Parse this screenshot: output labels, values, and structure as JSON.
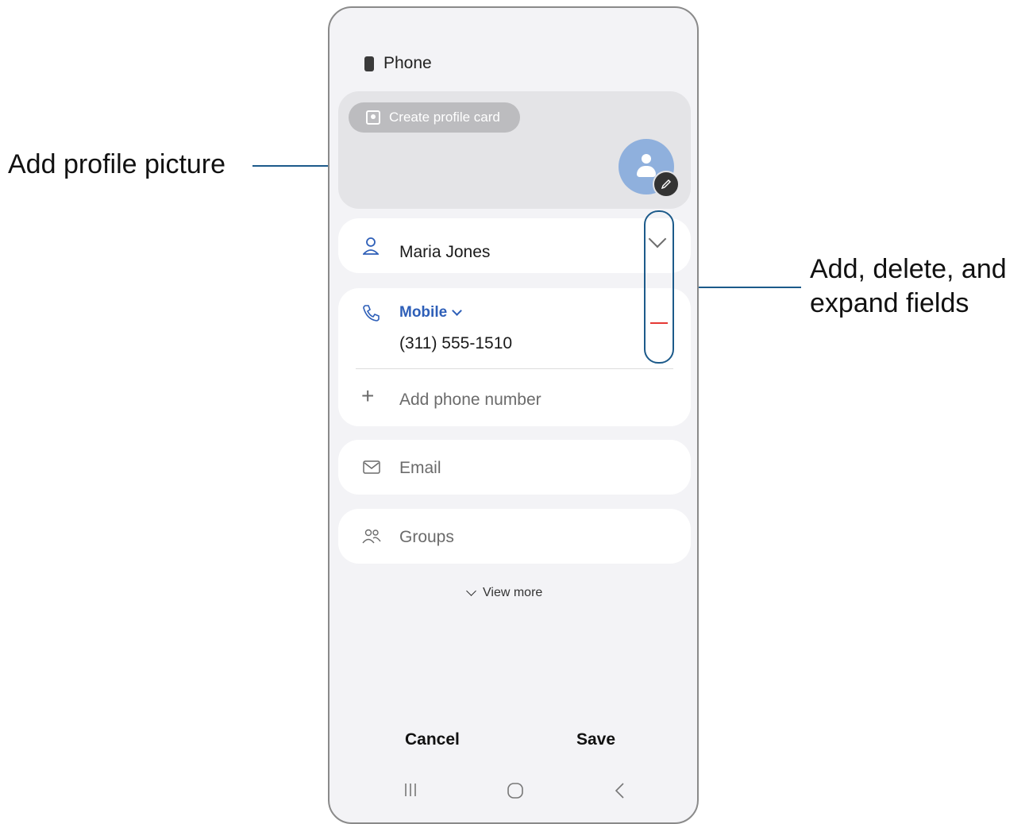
{
  "callouts": {
    "left": "Add profile picture",
    "right_line1": "Add, delete, and",
    "right_line2": "expand fields"
  },
  "storage": {
    "label": "Phone",
    "icon": "phone-device-icon"
  },
  "header": {
    "create_profile_label": "Create profile card",
    "avatar_icon": "person-avatar-icon",
    "edit_icon": "pencil-icon"
  },
  "name_field": {
    "value": "Maria Jones",
    "icon": "person-icon",
    "expand_icon": "chevron-down-icon"
  },
  "phone_field": {
    "type_label": "Mobile",
    "type_chevron": "chevron-down-icon",
    "value": "(311) 555-1510",
    "icon": "phone-icon",
    "remove_icon": "minus-icon",
    "add_placeholder": "Add phone number",
    "add_icon": "plus-icon"
  },
  "email_field": {
    "placeholder": "Email",
    "icon": "mail-icon"
  },
  "groups_field": {
    "placeholder": "Groups",
    "icon": "groups-icon"
  },
  "view_more": "View more",
  "actions": {
    "cancel": "Cancel",
    "save": "Save"
  },
  "nav": {
    "recents": "recents-icon",
    "home": "home-icon",
    "back": "back-icon"
  },
  "colors": {
    "accent_blue": "#2e5fb8",
    "callout_line": "#1c5a8a",
    "remove_red": "#e53935"
  }
}
